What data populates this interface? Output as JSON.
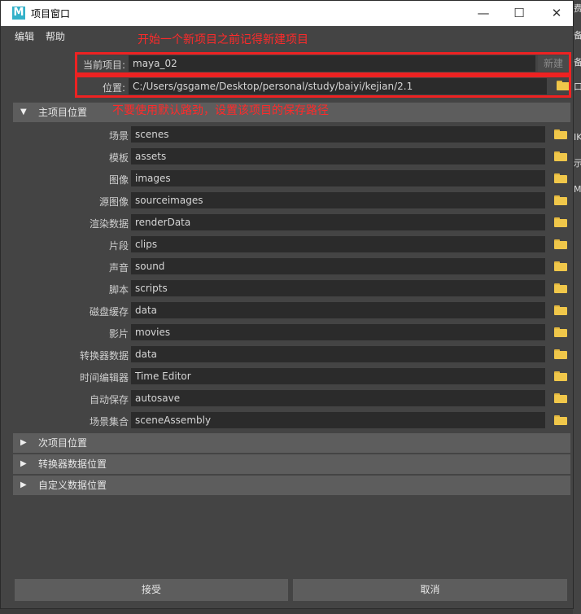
{
  "window": {
    "title": "项目窗口",
    "app_icon": "M",
    "controls": {
      "minimize": "—",
      "maximize": "☐",
      "close": "✕"
    }
  },
  "menu": {
    "items": [
      "编辑",
      "帮助"
    ]
  },
  "annotations": {
    "top": "开始一个新项目之前记得新建项目",
    "path": "不要使用默认路劲，设置该项目的保存路径"
  },
  "current_project": {
    "label": "当前项目:",
    "value": "maya_02",
    "new_button": "新建"
  },
  "location": {
    "label": "位置:",
    "value": "C:/Users/gsgame/Desktop/personal/study/baiyi/kejian/2.1"
  },
  "primary_section": {
    "title": "主项目位置",
    "rows": [
      {
        "label": "场景",
        "value": "scenes"
      },
      {
        "label": "模板",
        "value": "assets"
      },
      {
        "label": "图像",
        "value": "images"
      },
      {
        "label": "源图像",
        "value": "sourceimages"
      },
      {
        "label": "渲染数据",
        "value": "renderData"
      },
      {
        "label": "片段",
        "value": "clips"
      },
      {
        "label": "声音",
        "value": "sound"
      },
      {
        "label": "脚本",
        "value": "scripts"
      },
      {
        "label": "磁盘缓存",
        "value": "data"
      },
      {
        "label": "影片",
        "value": "movies"
      },
      {
        "label": "转换器数据",
        "value": "data"
      },
      {
        "label": "时间编辑器",
        "value": "Time Editor"
      },
      {
        "label": "自动保存",
        "value": "autosave"
      },
      {
        "label": "场景集合",
        "value": "sceneAssembly"
      }
    ]
  },
  "collapsed_sections": [
    "次项目位置",
    "转换器数据位置",
    "自定义数据位置"
  ],
  "buttons": {
    "accept": "接受",
    "cancel": "取消"
  },
  "background_fragments": [
    "费",
    "备",
    "口",
    "IK",
    "示",
    "M"
  ],
  "icons": {
    "folder": "folder-icon",
    "expanded": "triangle-down-icon",
    "collapsed": "triangle-right-icon"
  },
  "colors": {
    "annotation": "#ff2a2a",
    "folder": "#f0c74a",
    "field_bg": "#2b2b2b",
    "panel_bg": "#444444"
  }
}
